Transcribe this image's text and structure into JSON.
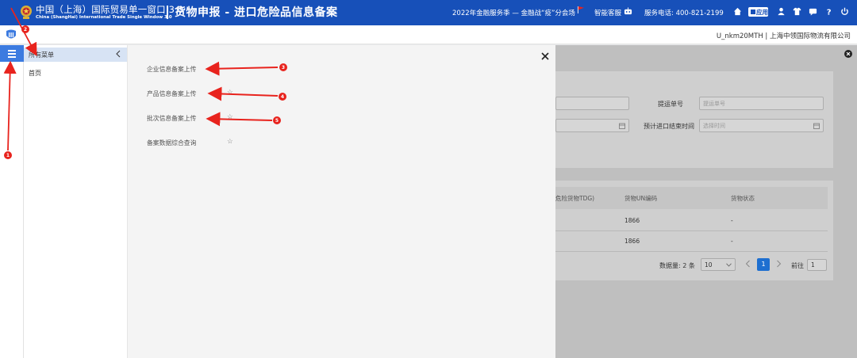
{
  "header": {
    "brand_cn": "中国（上海）国际贸易单一窗口 3.0",
    "brand_en": "China (ShangHai) International Trade Single Window 3.0",
    "page_title": "货物申报 - 进口危险品信息备案",
    "promo": "2022年金融服务季 — 金融战“疫”分会场",
    "support_label": "智能客服",
    "phone": "服务电话: 400-821-2199",
    "apps_label": "应用"
  },
  "subheader": {
    "user_info": "U_nkm20MTH | 上海中领国际物流有限公司"
  },
  "menu": {
    "header_label": "所有菜单",
    "home_label": "首页"
  },
  "submenu": {
    "items": [
      {
        "label": "企业信息备案上传",
        "starred": false
      },
      {
        "label": "产品信息备案上传",
        "starred": true
      },
      {
        "label": "批次信息备案上传",
        "starred": true
      },
      {
        "label": "备案数据综合查询",
        "starred": true
      }
    ]
  },
  "background_form": {
    "bill_label": "提运单号",
    "bill_placeholder": "提运单号",
    "eta_label": "预计进口结束时间",
    "date_placeholder": "选择时间"
  },
  "background_table": {
    "columns": [
      "危险货物TDG)",
      "货物UN编码",
      "货物状态"
    ],
    "rows": [
      {
        "un_code": "1866",
        "status": "-"
      },
      {
        "un_code": "1866",
        "status": "-"
      }
    ],
    "total_label": "数据量: 2 条",
    "page_size": "10",
    "current_page": "1",
    "goto_label": "前往",
    "goto_value": "1"
  },
  "annotations": [
    "1",
    "2",
    "3",
    "4",
    "5"
  ],
  "colors": {
    "header_blue": "#1750b9",
    "menu_button": "#3c7be0",
    "annotation_red": "#e8231d",
    "current_page": "#1e6fd0"
  },
  "icons": {
    "topbar": [
      "home-icon",
      "apps-grid-icon",
      "user-icon",
      "shirt-icon",
      "message-icon",
      "help-icon",
      "power-icon"
    ]
  }
}
